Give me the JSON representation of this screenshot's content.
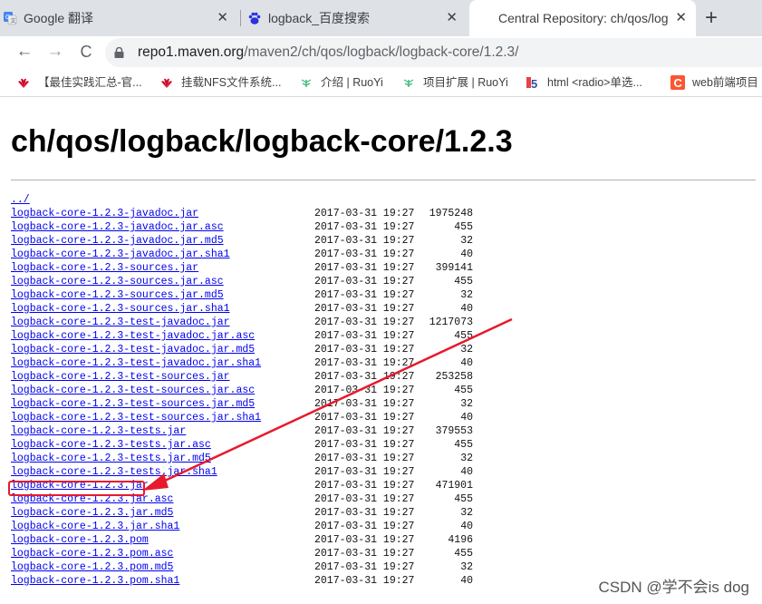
{
  "tabs": [
    {
      "title": "Google 翻译",
      "close": "✕",
      "icon": "google-translate-icon",
      "active": false
    },
    {
      "title": "logback_百度搜索",
      "close": "✕",
      "icon": "baidu-paw-icon",
      "active": false
    },
    {
      "title": "Central Repository: ch/qos/log",
      "close": "✕",
      "icon": "none",
      "active": true
    }
  ],
  "new_tab_label": "+",
  "toolbar": {
    "back": "←",
    "forward": "→",
    "reload": "C",
    "url_host": "repo1.maven.org",
    "url_path": "/maven2/ch/qos/logback/logback-core/1.2.3/"
  },
  "bookmarks": [
    {
      "label": "【最佳实践汇总-官...",
      "icon": "huawei-icon"
    },
    {
      "label": "挂载NFS文件系统...",
      "icon": "huawei-icon"
    },
    {
      "label": "介绍 | RuoYi",
      "icon": "ruoyi-leaf-icon"
    },
    {
      "label": "项目扩展 | RuoYi",
      "icon": "ruoyi-leaf-icon"
    },
    {
      "label": "html <radio>单选...",
      "icon": "w3c-icon"
    },
    {
      "label": "web前端项目",
      "icon": "csdn-c-icon"
    }
  ],
  "page": {
    "title": "ch/qos/logback/logback-core/1.2.3",
    "parent_link": "../",
    "files": [
      {
        "name": "logback-core-1.2.3-javadoc.jar",
        "date": "2017-03-31 19:27",
        "size": "1975248"
      },
      {
        "name": "logback-core-1.2.3-javadoc.jar.asc",
        "date": "2017-03-31 19:27",
        "size": "455"
      },
      {
        "name": "logback-core-1.2.3-javadoc.jar.md5",
        "date": "2017-03-31 19:27",
        "size": "32"
      },
      {
        "name": "logback-core-1.2.3-javadoc.jar.sha1",
        "date": "2017-03-31 19:27",
        "size": "40"
      },
      {
        "name": "logback-core-1.2.3-sources.jar",
        "date": "2017-03-31 19:27",
        "size": "399141"
      },
      {
        "name": "logback-core-1.2.3-sources.jar.asc",
        "date": "2017-03-31 19:27",
        "size": "455"
      },
      {
        "name": "logback-core-1.2.3-sources.jar.md5",
        "date": "2017-03-31 19:27",
        "size": "32"
      },
      {
        "name": "logback-core-1.2.3-sources.jar.sha1",
        "date": "2017-03-31 19:27",
        "size": "40"
      },
      {
        "name": "logback-core-1.2.3-test-javadoc.jar",
        "date": "2017-03-31 19:27",
        "size": "1217073"
      },
      {
        "name": "logback-core-1.2.3-test-javadoc.jar.asc",
        "date": "2017-03-31 19:27",
        "size": "455"
      },
      {
        "name": "logback-core-1.2.3-test-javadoc.jar.md5",
        "date": "2017-03-31 19:27",
        "size": "32"
      },
      {
        "name": "logback-core-1.2.3-test-javadoc.jar.sha1",
        "date": "2017-03-31 19:27",
        "size": "40"
      },
      {
        "name": "logback-core-1.2.3-test-sources.jar",
        "date": "2017-03-31 19:27",
        "size": "253258"
      },
      {
        "name": "logback-core-1.2.3-test-sources.jar.asc",
        "date": "2017-03-31 19:27",
        "size": "455"
      },
      {
        "name": "logback-core-1.2.3-test-sources.jar.md5",
        "date": "2017-03-31 19:27",
        "size": "32"
      },
      {
        "name": "logback-core-1.2.3-test-sources.jar.sha1",
        "date": "2017-03-31 19:27",
        "size": "40"
      },
      {
        "name": "logback-core-1.2.3-tests.jar",
        "date": "2017-03-31 19:27",
        "size": "379553"
      },
      {
        "name": "logback-core-1.2.3-tests.jar.asc",
        "date": "2017-03-31 19:27",
        "size": "455"
      },
      {
        "name": "logback-core-1.2.3-tests.jar.md5",
        "date": "2017-03-31 19:27",
        "size": "32"
      },
      {
        "name": "logback-core-1.2.3-tests.jar.sha1",
        "date": "2017-03-31 19:27",
        "size": "40"
      },
      {
        "name": "logback-core-1.2.3.jar",
        "date": "2017-03-31 19:27",
        "size": "471901",
        "highlighted": true
      },
      {
        "name": "logback-core-1.2.3.jar.asc",
        "date": "2017-03-31 19:27",
        "size": "455"
      },
      {
        "name": "logback-core-1.2.3.jar.md5",
        "date": "2017-03-31 19:27",
        "size": "32"
      },
      {
        "name": "logback-core-1.2.3.jar.sha1",
        "date": "2017-03-31 19:27",
        "size": "40"
      },
      {
        "name": "logback-core-1.2.3.pom",
        "date": "2017-03-31 19:27",
        "size": "4196"
      },
      {
        "name": "logback-core-1.2.3.pom.asc",
        "date": "2017-03-31 19:27",
        "size": "455"
      },
      {
        "name": "logback-core-1.2.3.pom.md5",
        "date": "2017-03-31 19:27",
        "size": "32"
      },
      {
        "name": "logback-core-1.2.3.pom.sha1",
        "date": "2017-03-31 19:27",
        "size": "40"
      }
    ]
  },
  "annotation_color": "#e8192c",
  "link_color": "#0000ee",
  "watermark": "CSDN @学不会is dog"
}
